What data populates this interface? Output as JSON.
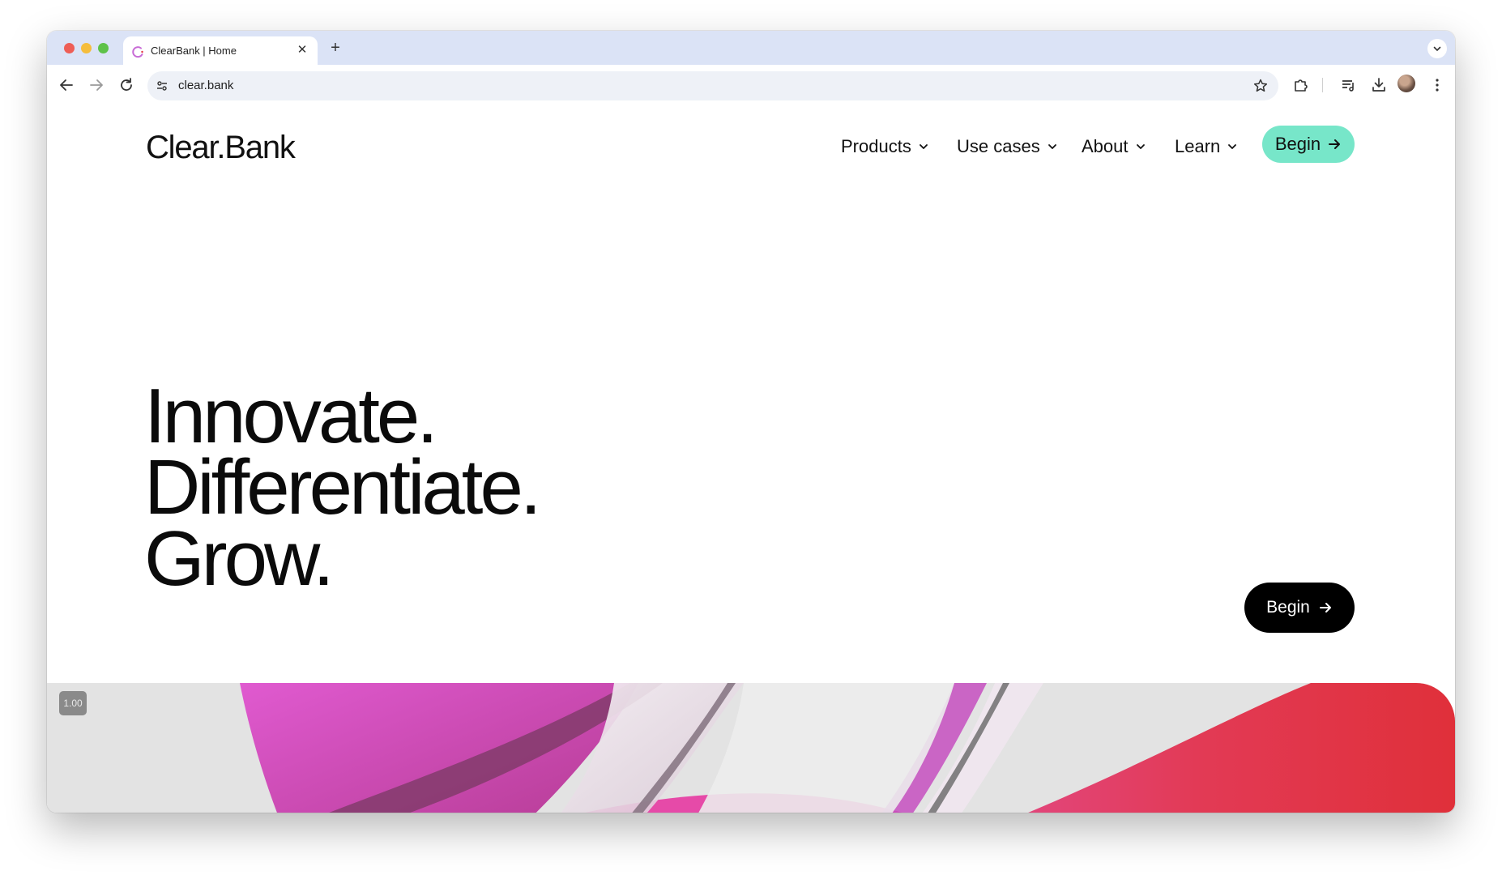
{
  "browser": {
    "tab": {
      "title": "ClearBank | Home",
      "close_glyph": "✕"
    },
    "new_tab_glyph": "+",
    "address": {
      "url": "clear.bank"
    }
  },
  "site": {
    "logo": "Clear.Bank",
    "nav": [
      {
        "label": "Products"
      },
      {
        "label": "Use cases"
      },
      {
        "label": "About"
      },
      {
        "label": "Learn"
      }
    ],
    "header_cta": "Begin",
    "hero": {
      "lines": [
        "Innovate.",
        "Differentiate.",
        "Grow."
      ],
      "cta": "Begin"
    },
    "media_badge": "1.00"
  },
  "colors": {
    "cta_mint": "#77e6c9",
    "cta_dark": "#000000",
    "magenta": "#d94fc3",
    "red": "#e2303a",
    "tabstrip": "#dbe3f6"
  },
  "icons": {
    "back": "arrow-left-icon",
    "forward": "arrow-right-icon",
    "reload": "reload-icon",
    "site_settings": "tune-icon",
    "bookmark": "star-icon",
    "extensions": "puzzle-icon",
    "media": "playlist-icon",
    "download": "download-icon",
    "menu": "kebab-menu-icon",
    "nav_dropdown": "chevron-down-icon",
    "cta_arrow": "arrow-right-icon"
  }
}
